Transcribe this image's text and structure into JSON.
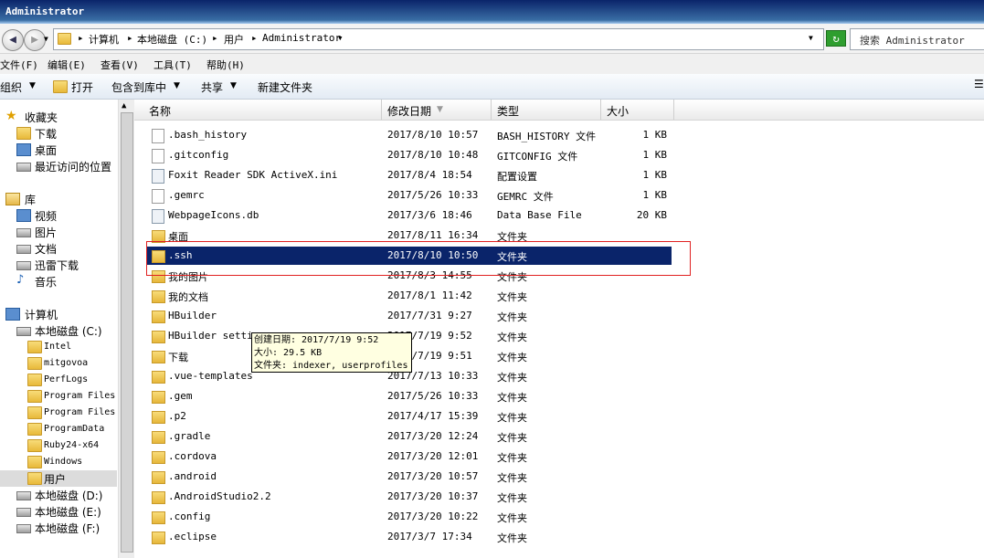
{
  "window": {
    "title": "Administrator"
  },
  "address": {
    "crumbs": [
      "计算机",
      "本地磁盘 (C:)",
      "用户",
      "Administrator"
    ],
    "search_placeholder": "搜索 Administrator"
  },
  "menu": [
    "文件(F)",
    "编辑(E)",
    "查看(V)",
    "工具(T)",
    "帮助(H)"
  ],
  "toolbar": {
    "organize": "组织",
    "open": "打开",
    "include_library": "包含到库中",
    "share": "共享",
    "new_folder": "新建文件夹"
  },
  "nav": {
    "favorites": "收藏夹",
    "fav_items": [
      "下载",
      "桌面",
      "最近访问的位置"
    ],
    "libraries": "库",
    "lib_items": [
      "视频",
      "图片",
      "文档",
      "迅雷下载",
      "音乐"
    ],
    "computer": "计算机",
    "drive_c": "本地磁盘 (C:)",
    "c_items": [
      "Intel",
      "mitgovoa",
      "PerfLogs",
      "Program Files",
      "Program Files",
      "ProgramData",
      "Ruby24-x64",
      "Windows",
      "用户"
    ],
    "drives": [
      "本地磁盘 (D:)",
      "本地磁盘 (E:)",
      "本地磁盘 (F:)"
    ]
  },
  "columns": {
    "name": "名称",
    "modified": "修改日期",
    "type": "类型",
    "size": "大小"
  },
  "rows": [
    {
      "name": ".bash_history",
      "date": "2017/8/10 10:57",
      "type": "BASH_HISTORY 文件",
      "size": "1 KB",
      "kind": "file"
    },
    {
      "name": ".gitconfig",
      "date": "2017/8/10 10:48",
      "type": "GITCONFIG 文件",
      "size": "1 KB",
      "kind": "file"
    },
    {
      "name": "Foxit Reader SDK ActiveX.ini",
      "date": "2017/8/4 18:54",
      "type": "配置设置",
      "size": "1 KB",
      "kind": "cfg"
    },
    {
      "name": ".gemrc",
      "date": "2017/5/26 10:33",
      "type": "GEMRC 文件",
      "size": "1 KB",
      "kind": "file"
    },
    {
      "name": "WebpageIcons.db",
      "date": "2017/3/6 18:46",
      "type": "Data Base File",
      "size": "20 KB",
      "kind": "cfg"
    },
    {
      "name": "桌面",
      "date": "2017/8/11 16:34",
      "type": "文件夹",
      "size": "",
      "kind": "folder"
    },
    {
      "name": ".ssh",
      "date": "2017/8/10 10:50",
      "type": "文件夹",
      "size": "",
      "kind": "folder",
      "selected": true
    },
    {
      "name": "我的图片",
      "date": "2017/8/3 14:55",
      "type": "文件夹",
      "size": "",
      "kind": "folder"
    },
    {
      "name": "我的文档",
      "date": "2017/8/1 11:42",
      "type": "文件夹",
      "size": "",
      "kind": "folder"
    },
    {
      "name": "HBuilder",
      "date": "2017/7/31 9:27",
      "type": "文件夹",
      "size": "",
      "kind": "folder"
    },
    {
      "name": "HBuilder settin",
      "date": "2017/7/19 9:52",
      "type": "文件夹",
      "size": "",
      "kind": "folder"
    },
    {
      "name": "下载",
      "date": "2017/7/19 9:51",
      "type": "文件夹",
      "size": "",
      "kind": "folder"
    },
    {
      "name": ".vue-templates",
      "date": "2017/7/13 10:33",
      "type": "文件夹",
      "size": "",
      "kind": "folder"
    },
    {
      "name": ".gem",
      "date": "2017/5/26 10:33",
      "type": "文件夹",
      "size": "",
      "kind": "folder"
    },
    {
      "name": ".p2",
      "date": "2017/4/17 15:39",
      "type": "文件夹",
      "size": "",
      "kind": "folder"
    },
    {
      "name": ".gradle",
      "date": "2017/3/20 12:24",
      "type": "文件夹",
      "size": "",
      "kind": "folder"
    },
    {
      "name": ".cordova",
      "date": "2017/3/20 12:01",
      "type": "文件夹",
      "size": "",
      "kind": "folder"
    },
    {
      "name": ".android",
      "date": "2017/3/20 10:57",
      "type": "文件夹",
      "size": "",
      "kind": "folder"
    },
    {
      "name": ".AndroidStudio2.2",
      "date": "2017/3/20 10:37",
      "type": "文件夹",
      "size": "",
      "kind": "folder"
    },
    {
      "name": ".config",
      "date": "2017/3/20 10:22",
      "type": "文件夹",
      "size": "",
      "kind": "folder"
    },
    {
      "name": ".eclipse",
      "date": "2017/3/7 17:34",
      "type": "文件夹",
      "size": "",
      "kind": "folder"
    }
  ],
  "tooltip": {
    "created": "创建日期: 2017/7/19 9:52",
    "size": "大小: 29.5 KB",
    "folders": "文件夹: indexer, userprofiles"
  }
}
